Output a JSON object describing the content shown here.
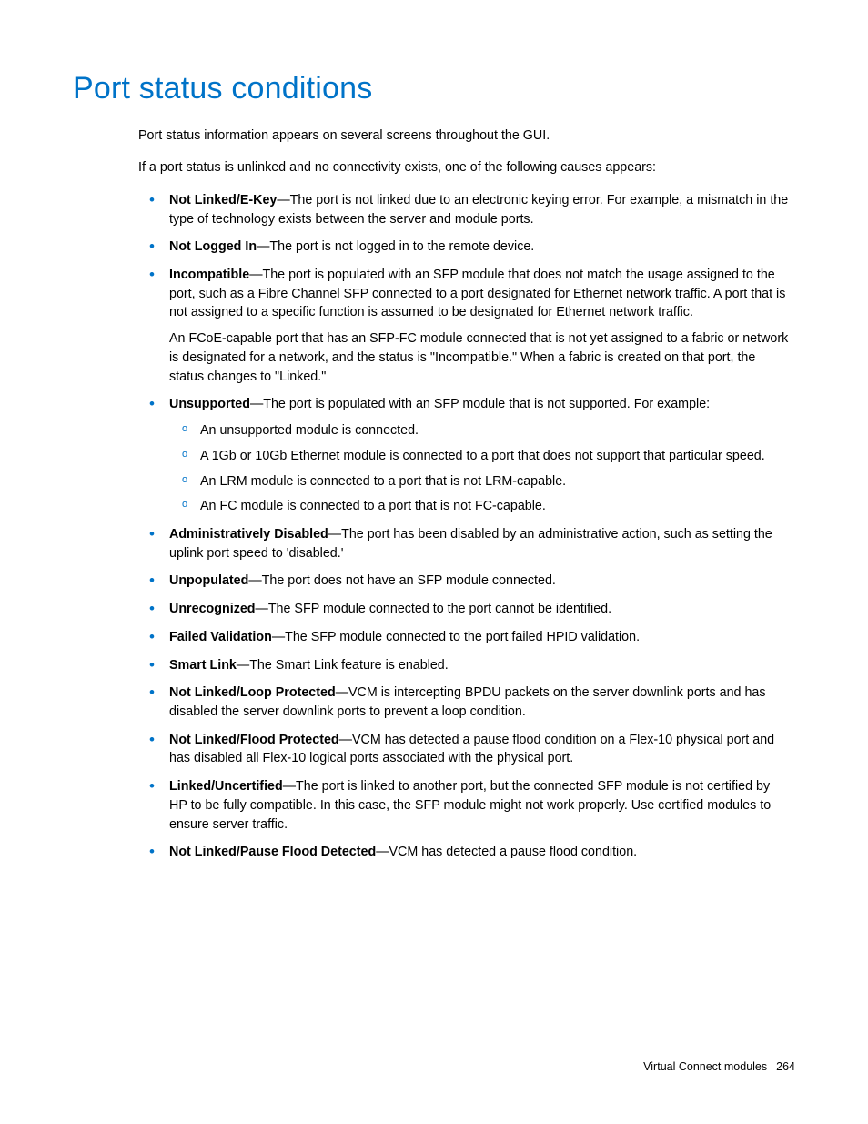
{
  "title": "Port status conditions",
  "intro": {
    "p1": "Port status information appears on several screens throughout the GUI.",
    "p2": "If a port status is unlinked and no connectivity exists, one of the following causes appears:"
  },
  "items": [
    {
      "term": "Not Linked/E-Key",
      "desc": "—The port is not linked due to an electronic keying error. For example, a mismatch in the type of technology exists between the server and module ports."
    },
    {
      "term": "Not Logged In",
      "desc": "—The port is not logged in to the remote device."
    },
    {
      "term": "Incompatible",
      "desc": "—The port is populated with an SFP module that does not match the usage assigned to the port, such as a Fibre Channel SFP connected to a port designated for Ethernet network traffic. A port that is not assigned to a specific function is assumed to be designated for Ethernet network traffic.",
      "extra": "An FCoE-capable port that has an SFP-FC module connected that is not yet assigned to a fabric or network is designated for a network, and the status is \"Incompatible.\" When a fabric is created on that port, the status changes to \"Linked.\""
    },
    {
      "term": "Unsupported",
      "desc": "—The port is populated with an SFP module that is not supported. For example:",
      "sub": [
        "An unsupported module is connected.",
        "A 1Gb or 10Gb Ethernet module is connected to a port that does not support that particular speed.",
        "An LRM module is connected to a port that is not LRM-capable.",
        "An FC module is connected to a port that is not FC-capable."
      ]
    },
    {
      "term": "Administratively Disabled",
      "desc": "—The port has been disabled by an administrative action, such as setting the uplink port speed to 'disabled.'"
    },
    {
      "term": "Unpopulated",
      "desc": "—The port does not have an SFP module connected."
    },
    {
      "term": "Unrecognized",
      "desc": "—The SFP module connected to the port cannot be identified."
    },
    {
      "term": "Failed Validation",
      "desc": "—The SFP module connected to the port failed HPID validation."
    },
    {
      "term": "Smart Link",
      "desc": "—The Smart Link feature is enabled."
    },
    {
      "term": "Not Linked/Loop Protected",
      "desc": "—VCM is intercepting BPDU packets on the server downlink ports and has disabled the server downlink ports to prevent a loop condition."
    },
    {
      "term": "Not Linked/Flood Protected",
      "desc": "—VCM has detected a pause flood condition on a Flex-10 physical port and has disabled all Flex-10 logical ports associated with the physical port."
    },
    {
      "term": "Linked/Uncertified",
      "desc": "—The port is linked to another port, but the connected SFP module is not certified by HP to be fully compatible. In this case, the SFP module might not work properly. Use certified modules to ensure server traffic."
    },
    {
      "term": "Not Linked/Pause Flood Detected",
      "desc": "—VCM has detected a pause flood condition."
    }
  ],
  "footer": {
    "section": "Virtual Connect modules",
    "page": "264"
  }
}
